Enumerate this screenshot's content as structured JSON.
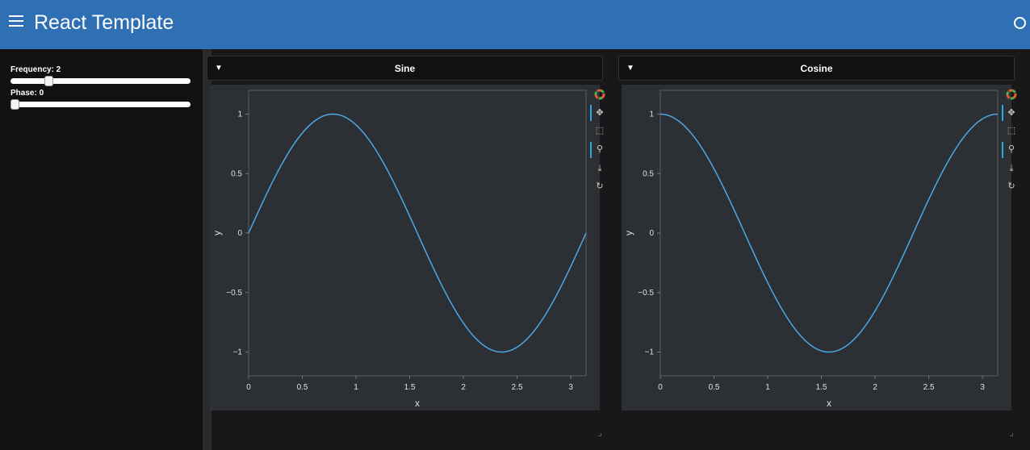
{
  "header": {
    "title": "React Template",
    "menu_icon": "hamburger-menu-icon",
    "status_icon": "circle-status-icon",
    "bg_color": "#2f70b4"
  },
  "sidebar": {
    "frequency_label": "Frequency: 2",
    "frequency_value": 2,
    "phase_label": "Phase: 0",
    "phase_value": 0
  },
  "plots": [
    {
      "title": "Sine",
      "chart_data": {
        "type": "line",
        "title": "",
        "xlabel": "x",
        "ylabel": "y",
        "xlim": [
          0,
          3.14159
        ],
        "ylim": [
          -1.2,
          1.2
        ],
        "xticks": [
          "0",
          "0.5",
          "1",
          "1.5",
          "2",
          "2.5",
          "3"
        ],
        "yticks": [
          "1",
          "0.5",
          "0",
          "−0.5",
          "−1"
        ],
        "series": [
          {
            "function": "sin(2x)",
            "color": "#4ea8e6",
            "x": [
              0,
              0.393,
              0.785,
              1.178,
              1.571,
              1.963,
              2.356,
              2.749,
              3.142
            ],
            "y": [
              0,
              0.707,
              1,
              0.707,
              0,
              -0.707,
              -1,
              -0.707,
              0
            ]
          }
        ]
      }
    },
    {
      "title": "Cosine",
      "chart_data": {
        "type": "line",
        "title": "",
        "xlabel": "x",
        "ylabel": "y",
        "xlim": [
          0,
          3.14159
        ],
        "ylim": [
          -1.2,
          1.2
        ],
        "xticks": [
          "0",
          "0.5",
          "1",
          "1.5",
          "2",
          "2.5",
          "3"
        ],
        "yticks": [
          "1",
          "0.5",
          "0",
          "−0.5",
          "−1"
        ],
        "series": [
          {
            "function": "cos(2x)",
            "color": "#4ea8e6",
            "x": [
              0,
              0.393,
              0.785,
              1.178,
              1.571,
              1.963,
              2.356,
              2.749,
              3.142
            ],
            "y": [
              1,
              0.707,
              0,
              -0.707,
              -1,
              -0.707,
              0,
              0.707,
              1
            ]
          }
        ]
      }
    }
  ],
  "toolbar_icons": [
    "bokeh-logo-icon",
    "pan-icon",
    "box-zoom-icon",
    "wheel-zoom-icon",
    "save-icon",
    "reset-icon"
  ]
}
